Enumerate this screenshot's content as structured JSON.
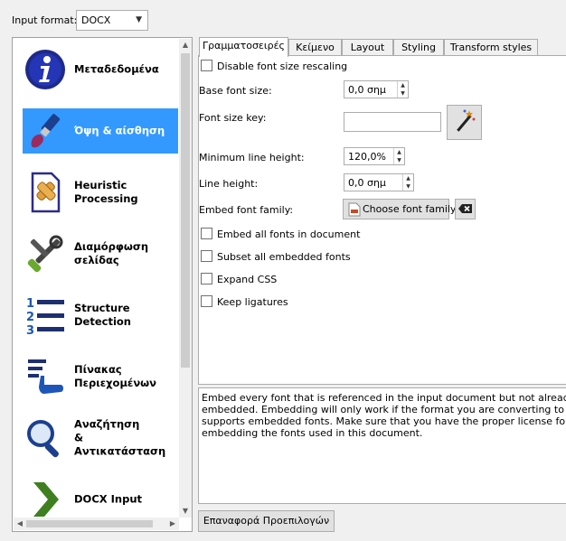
{
  "input_format": {
    "label": "Input format:",
    "value": "DOCX"
  },
  "sidebar": {
    "items": [
      {
        "label": "Μεταδεδομένα",
        "icon": "info-icon",
        "selected": false
      },
      {
        "label": "Όψη & αίσθηση",
        "icon": "paintbrush-icon",
        "selected": true
      },
      {
        "label": "Heuristic\nProcessing",
        "icon": "document-bandage-icon",
        "selected": false
      },
      {
        "label": "Διαμόρφωση σελίδας",
        "icon": "tools-icon",
        "selected": false
      },
      {
        "label": "Structure\nDetection",
        "icon": "numbered-list-icon",
        "selected": false
      },
      {
        "label": "Πίνακας\nΠεριεχομένων",
        "icon": "toc-hand-icon",
        "selected": false
      },
      {
        "label": "Αναζήτηση\n&\nΑντικατάσταση",
        "icon": "magnifier-icon",
        "selected": false
      },
      {
        "label": "DOCX Input",
        "icon": "chevron-right-icon",
        "selected": false
      }
    ]
  },
  "tabs": [
    {
      "label": "Γραμματοσειρές",
      "active": true
    },
    {
      "label": "Κείμενο",
      "active": false
    },
    {
      "label": "Layout",
      "active": false
    },
    {
      "label": "Styling",
      "active": false
    },
    {
      "label": "Transform styles",
      "active": false
    }
  ],
  "fonts_tab": {
    "disable_rescaling": "Disable font size rescaling",
    "base_font_size_label": "Base font size:",
    "base_font_size_value": "0,0 σημ",
    "font_size_key_label": "Font size key:",
    "font_size_key_value": "",
    "min_line_height_label": "Minimum line height:",
    "min_line_height_value": "120,0%",
    "line_height_label": "Line height:",
    "line_height_value": "0,0 σημ",
    "embed_family_label": "Embed font family:",
    "choose_font_family": "Choose font family",
    "embed_all_fonts": "Embed all fonts in document",
    "subset_fonts": "Subset all embedded fonts",
    "expand_css": "Expand CSS",
    "keep_ligatures": "Keep ligatures"
  },
  "description": "Embed every font that is referenced in the input document but not already embedded. Embedding will only work if the format you are converting to supports embedded fonts. Make sure that you have the proper license for embedding the fonts used in this document.",
  "reset_button": "Επαναφορά Προεπιλογών"
}
